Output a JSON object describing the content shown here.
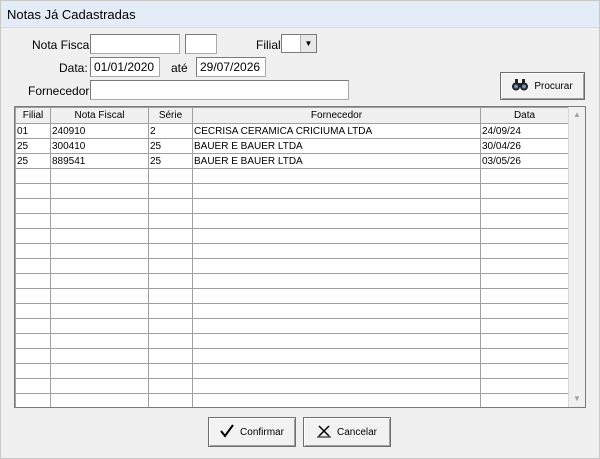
{
  "window": {
    "title": "Notas Já Cadastradas"
  },
  "filters": {
    "nota_fiscal_label": "Nota Fiscal:",
    "nota_fiscal_value": "",
    "serie_value": "",
    "filial_label": "Filial",
    "filial_value": "",
    "data_label": "Data:",
    "data_inicio": "01/01/2020",
    "ate_label": "até",
    "data_fim": "29/07/2026",
    "fornecedor_label": "Fornecedor:",
    "fornecedor_value": ""
  },
  "buttons": {
    "procurar": "Procurar",
    "confirmar": "Confirmar",
    "cancelar": "Cancelar"
  },
  "icons": {
    "procurar": "binoculars-icon",
    "confirmar": "checkmark-icon",
    "cancelar": "close-icon"
  },
  "grid": {
    "columns": [
      "Filial",
      "Nota Fiscal",
      "Série",
      "Fornecedor",
      "Data"
    ],
    "rows": [
      [
        "01",
        "240910",
        "2",
        "CECRISA CERAMICA CRICIUMA LTDA",
        "24/09/24"
      ],
      [
        "25",
        "300410",
        "25",
        "BAUER E BAUER LTDA",
        "30/04/26"
      ],
      [
        "25",
        "889541",
        "25",
        "BAUER E BAUER LTDA",
        "03/05/26"
      ]
    ]
  }
}
